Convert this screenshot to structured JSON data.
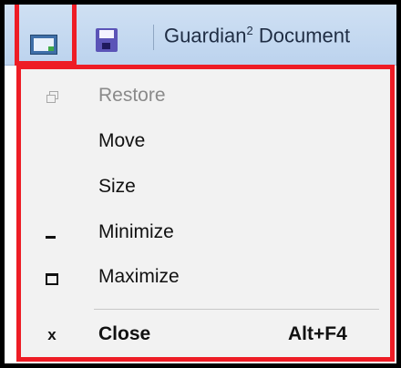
{
  "window": {
    "title": "Guardian",
    "title_sup": "2",
    "title_rest": " Document"
  },
  "menu": {
    "items": [
      {
        "label": "Restore",
        "icon": "restore-icon",
        "enabled": false
      },
      {
        "label": "Move",
        "icon": "",
        "enabled": true
      },
      {
        "label": "Size",
        "icon": "",
        "enabled": true
      },
      {
        "label": "Minimize",
        "icon": "minimize-icon",
        "enabled": true
      },
      {
        "label": "Maximize",
        "icon": "maximize-icon",
        "enabled": true
      },
      {
        "label": "Close",
        "icon": "close-icon",
        "enabled": true,
        "shortcut": "Alt+F4",
        "icon_glyph": "x"
      }
    ]
  },
  "colors": {
    "highlight_border": "#ee1c25",
    "menu_background": "#f2f2f2",
    "titlebar": "#c7dbf1",
    "disabled_text": "#8a8a8a"
  }
}
